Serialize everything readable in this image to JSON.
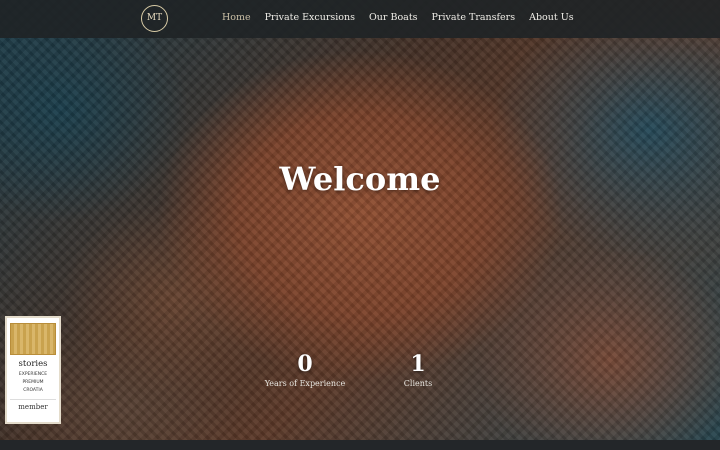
{
  "nav": {
    "logo_text": "MT",
    "items": [
      {
        "label": "Home",
        "active": true
      },
      {
        "label": "Private Excursions",
        "active": false
      },
      {
        "label": "Our Boats",
        "active": false
      },
      {
        "label": "Private Transfers",
        "active": false
      },
      {
        "label": "About Us",
        "active": false
      }
    ]
  },
  "hero": {
    "title": "Welcome"
  },
  "stats": [
    {
      "value": "0",
      "label": "Years of Experience"
    },
    {
      "value": "1",
      "label": "Clients"
    }
  ],
  "badge": {
    "title": "stories",
    "subtitle_line1": "EXPERIENCE",
    "subtitle_line2": "PREMIUM",
    "subtitle_line3": "CROATIA",
    "member": "member"
  },
  "colors": {
    "nav_bg": "#202426",
    "nav_text": "#f0eee8",
    "nav_active": "#c9bfa6",
    "hero_title": "#ffffff"
  }
}
